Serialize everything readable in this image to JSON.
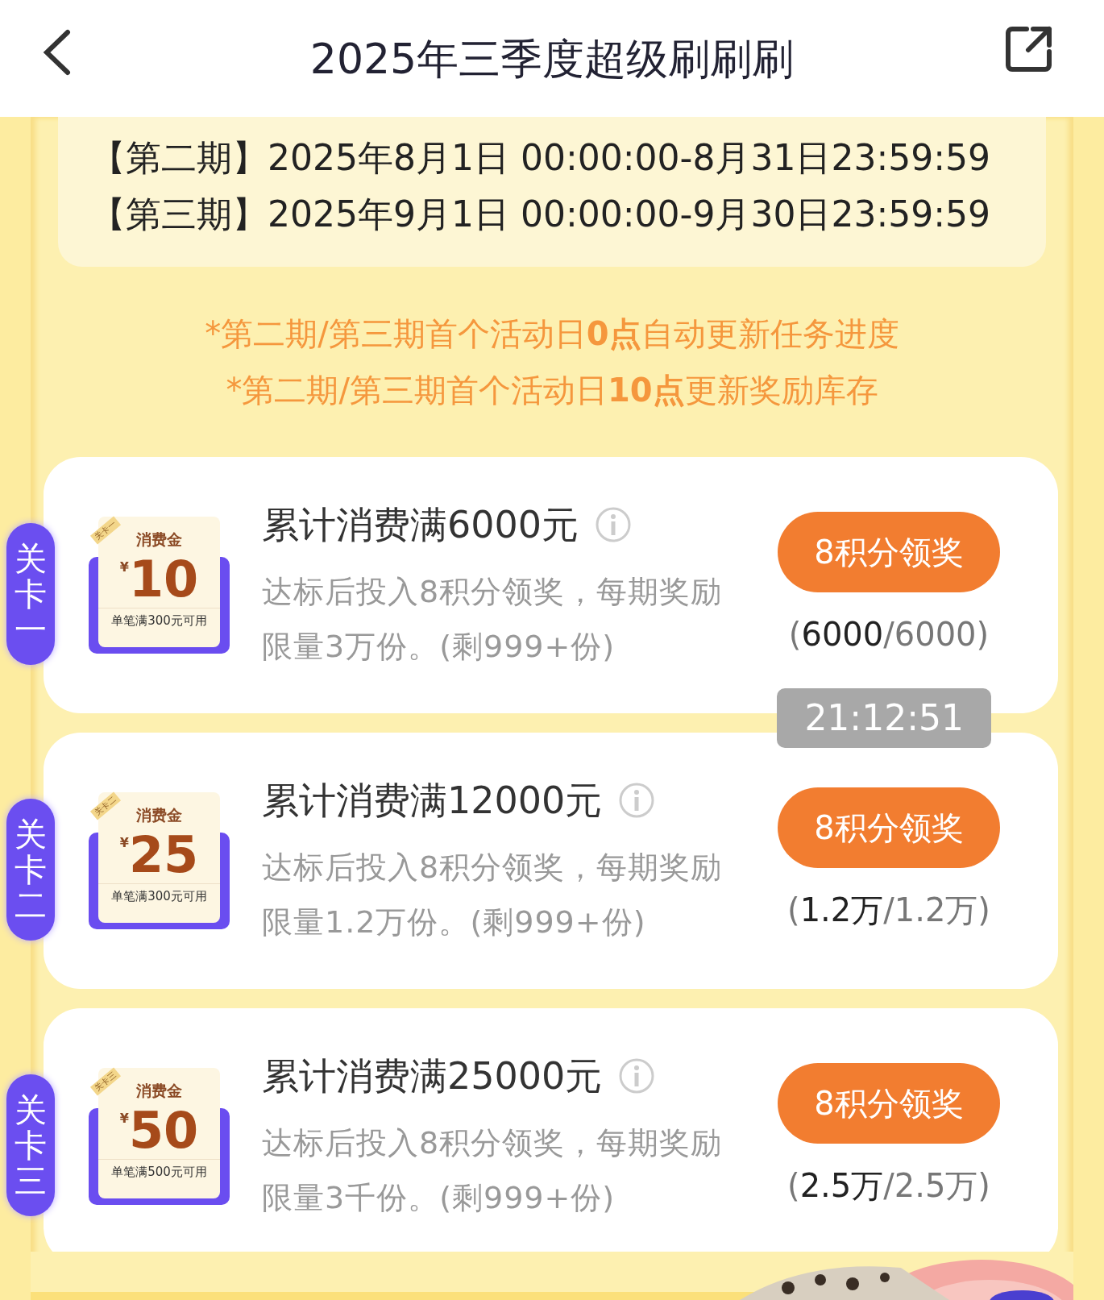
{
  "header": {
    "title": "2025年三季度超级刷刷刷"
  },
  "periods": [
    "【第二期】2025年8月1日 00:00:00-8月31日23:59:59",
    "【第三期】2025年9月1日 00:00:00-9月30日23:59:59"
  ],
  "notes": [
    "*第二期/第三期首个活动日**0点**自动更新任务进度",
    "*第二期/第三期首个活动日**10点**更新奖励库存"
  ],
  "tasks": [
    {
      "stage": "关卡一",
      "coupon": {
        "ribbon": "关卡一",
        "label": "消费金",
        "currency": "¥",
        "amount": "10",
        "condition": "单笔满300元可用"
      },
      "title": "累计消费满6000元",
      "description": "达标后投入8积分领奖，每期奖励限量3万份。(剩999+份)",
      "button": "8积分领奖",
      "progress": "(**6000**/6000)"
    },
    {
      "stage": "关卡二",
      "coupon": {
        "ribbon": "关卡二",
        "label": "消费金",
        "currency": "¥",
        "amount": "25",
        "condition": "单笔满300元可用"
      },
      "title": "累计消费满12000元",
      "description": "达标后投入8积分领奖，每期奖励限量1.2万份。(剩999+份)",
      "button": "8积分领奖",
      "progress": "(**1.2万**/1.2万)"
    },
    {
      "stage": "关卡三",
      "coupon": {
        "ribbon": "关卡三",
        "label": "消费金",
        "currency": "¥",
        "amount": "50",
        "condition": "单笔满500元可用"
      },
      "title": "累计消费满25000元",
      "description": "达标后投入8积分领奖，每期奖励限量3千份。(剩999+份)",
      "button": "8积分领奖",
      "progress": "(**2.5万**/2.5万)"
    }
  ],
  "toast": {
    "time": "21:12:51"
  },
  "footer": {
    "kind": "picture"
  }
}
